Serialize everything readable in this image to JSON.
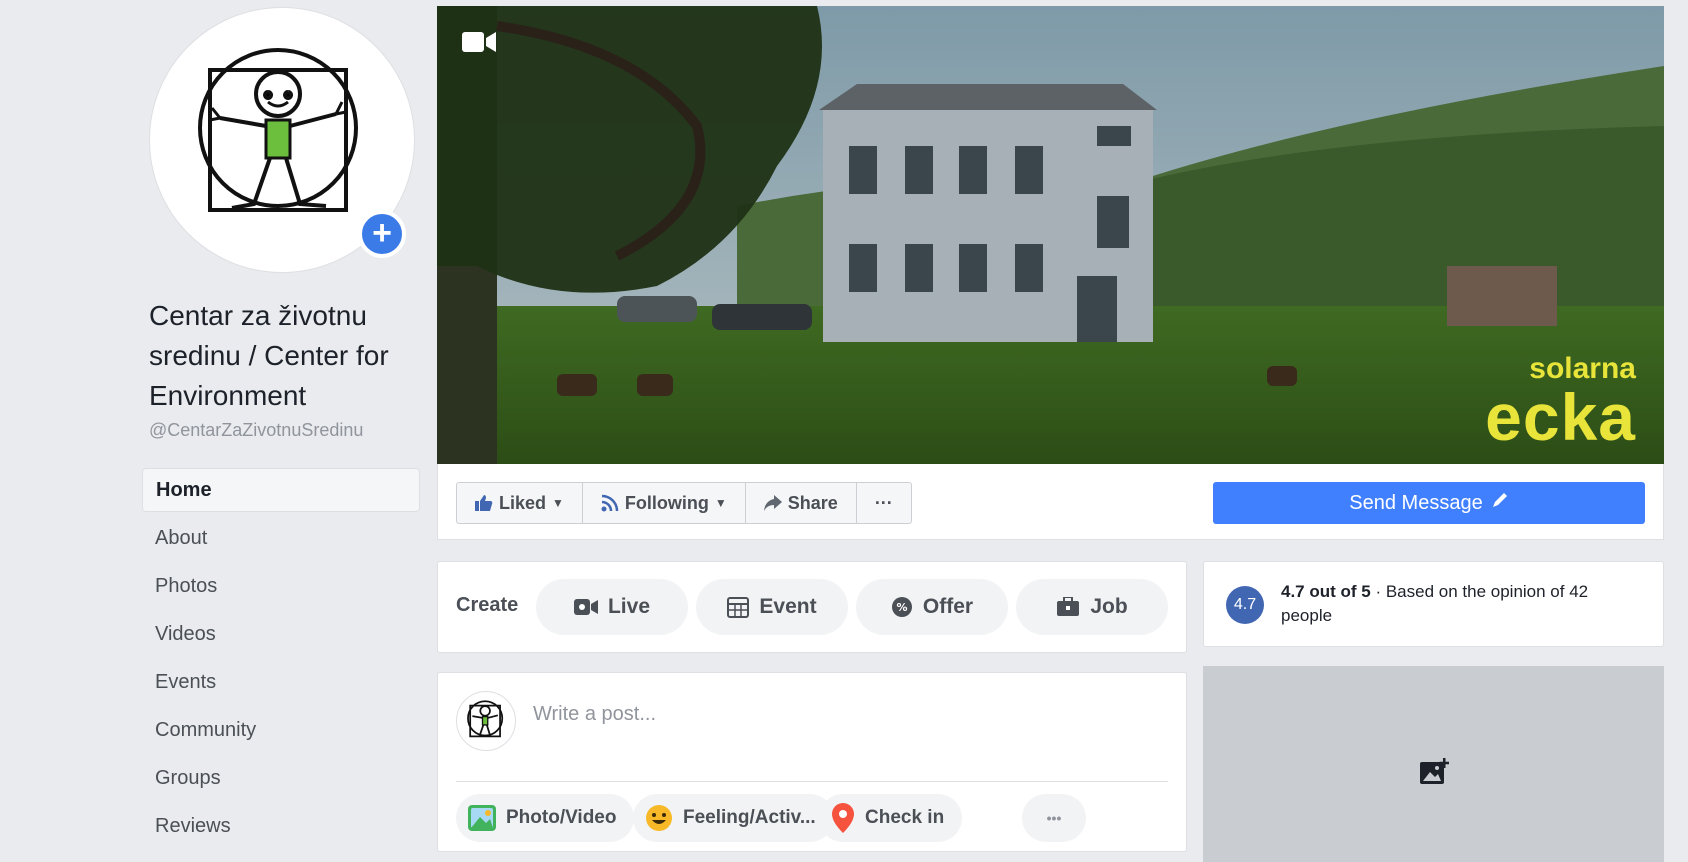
{
  "page": {
    "name": "Centar za životnu sredinu / Center for Environment",
    "handle": "@CentarZaZivotnuSredinu"
  },
  "nav": {
    "items": [
      {
        "label": "Home",
        "active": true
      },
      {
        "label": "About"
      },
      {
        "label": "Photos"
      },
      {
        "label": "Videos"
      },
      {
        "label": "Events"
      },
      {
        "label": "Community"
      },
      {
        "label": "Groups"
      },
      {
        "label": "Reviews"
      }
    ]
  },
  "cover": {
    "brand_top": "solarna",
    "brand_bottom": "ecka"
  },
  "actions": {
    "liked": "Liked",
    "following": "Following",
    "share": "Share",
    "more": "···",
    "send_message": "Send Message"
  },
  "create": {
    "label": "Create",
    "live": "Live",
    "event": "Event",
    "offer": "Offer",
    "job": "Job"
  },
  "rating": {
    "badge": "4.7",
    "score": "4.7 out of 5",
    "detail": " · Based on the opinion of 42 people"
  },
  "post": {
    "placeholder": "Write a post...",
    "photo_video": "Photo/Video",
    "feeling": "Feeling/Activ...",
    "check_in": "Check in",
    "more": "•••"
  },
  "colors": {
    "accent": "#4080ff",
    "facebook_blue": "#4267b2",
    "brand_yellow": "#e8e43a",
    "background": "#e9ebee"
  }
}
